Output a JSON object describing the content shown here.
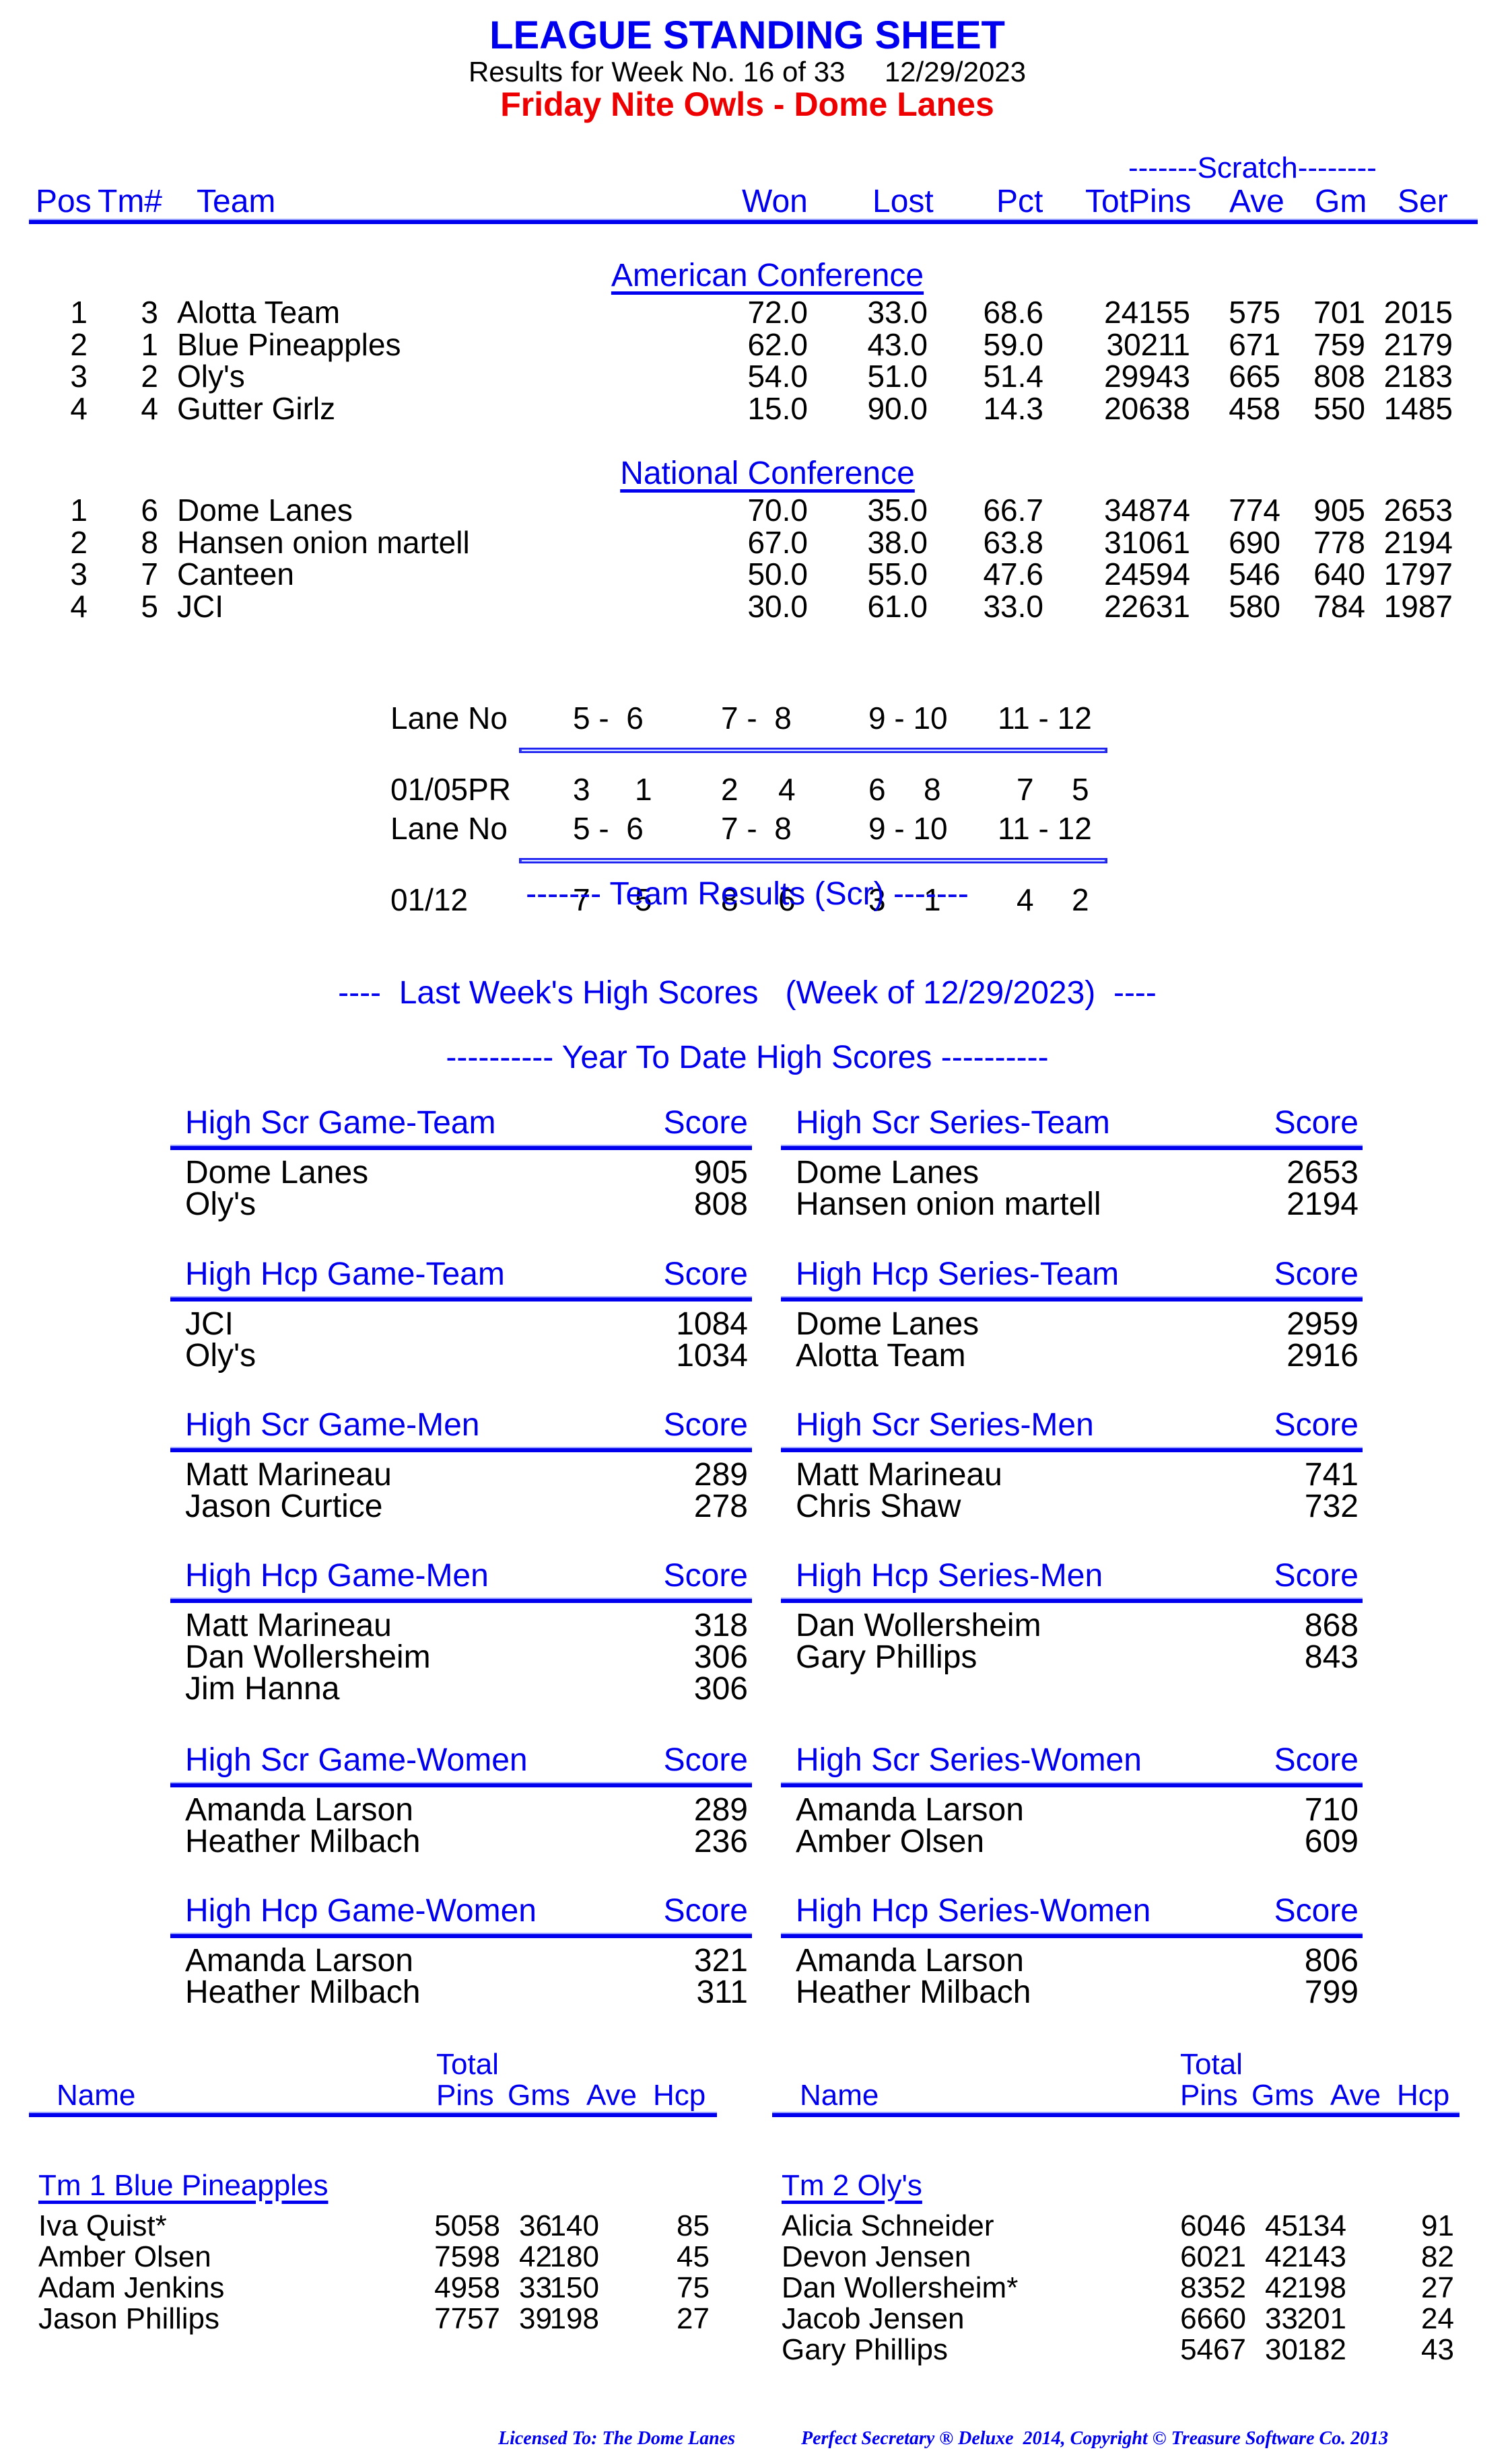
{
  "header": {
    "title": "LEAGUE STANDING SHEET",
    "subtitle": "Results for Week No. 16 of 33     12/29/2023",
    "league": "Friday Nite Owls - Dome Lanes"
  },
  "standings": {
    "scratch_label": "-------Scratch--------",
    "columns": {
      "pos": "Pos",
      "tm": "Tm#",
      "team": "Team",
      "won": "Won",
      "lost": "Lost",
      "pct": "Pct",
      "totpins": "TotPins",
      "ave": "Ave",
      "gm": "Gm",
      "ser": "Ser"
    },
    "conferences": [
      {
        "name": "American Conference",
        "rows": [
          {
            "pos": "1",
            "tm": "3",
            "team": "Alotta Team",
            "won": "72.0",
            "lost": "33.0",
            "pct": "68.6",
            "totpins": "24155",
            "ave": "575",
            "gm": "701",
            "ser": "2015"
          },
          {
            "pos": "2",
            "tm": "1",
            "team": "Blue Pineapples",
            "won": "62.0",
            "lost": "43.0",
            "pct": "59.0",
            "totpins": "30211",
            "ave": "671",
            "gm": "759",
            "ser": "2179"
          },
          {
            "pos": "3",
            "tm": "2",
            "team": "Oly's",
            "won": "54.0",
            "lost": "51.0",
            "pct": "51.4",
            "totpins": "29943",
            "ave": "665",
            "gm": "808",
            "ser": "2183"
          },
          {
            "pos": "4",
            "tm": "4",
            "team": "Gutter Girlz",
            "won": "15.0",
            "lost": "90.0",
            "pct": "14.3",
            "totpins": "20638",
            "ave": "458",
            "gm": "550",
            "ser": "1485"
          }
        ]
      },
      {
        "name": "National Conference",
        "rows": [
          {
            "pos": "1",
            "tm": "6",
            "team": "Dome Lanes",
            "won": "70.0",
            "lost": "35.0",
            "pct": "66.7",
            "totpins": "34874",
            "ave": "774",
            "gm": "905",
            "ser": "2653"
          },
          {
            "pos": "2",
            "tm": "8",
            "team": "Hansen onion martell",
            "won": "67.0",
            "lost": "38.0",
            "pct": "63.8",
            "totpins": "31061",
            "ave": "690",
            "gm": "778",
            "ser": "2194"
          },
          {
            "pos": "3",
            "tm": "7",
            "team": "Canteen",
            "won": "50.0",
            "lost": "55.0",
            "pct": "47.6",
            "totpins": "24594",
            "ave": "546",
            "gm": "640",
            "ser": "1797"
          },
          {
            "pos": "4",
            "tm": "5",
            "team": "JCI",
            "won": "30.0",
            "lost": "61.0",
            "pct": "33.0",
            "totpins": "22631",
            "ave": "580",
            "gm": "784",
            "ser": "1987"
          }
        ]
      }
    ]
  },
  "lanes": [
    {
      "label": "Lane No",
      "pairs": [
        "5 -  6",
        "7 -  8",
        "9 - 10",
        "11 - 12"
      ],
      "date": "01/05PR",
      "teams": [
        "3",
        "1",
        "2",
        "4",
        "6",
        "8",
        "7",
        "5"
      ]
    },
    {
      "label": "Lane No",
      "pairs": [
        "5 -  6",
        "7 -  8",
        "9 - 10",
        "11 - 12"
      ],
      "date": "01/12",
      "teams": [
        "7",
        "5",
        "8",
        "6",
        "3",
        "1",
        "4",
        "2"
      ]
    }
  ],
  "sections": {
    "team_results": "------- Team Results (Scr) -------",
    "last_week": "----  Last Week's High Scores   (Week of 12/29/2023)  ----",
    "ytd": "---------- Year To Date High Scores ----------"
  },
  "high_scores": {
    "score_label": "Score",
    "blocks": [
      {
        "title": "High Scr Game-Team",
        "entries": [
          {
            "name": "Dome Lanes",
            "score": "905"
          },
          {
            "name": "Oly's",
            "score": "808"
          }
        ]
      },
      {
        "title": "High Scr Series-Team",
        "entries": [
          {
            "name": "Dome Lanes",
            "score": "2653"
          },
          {
            "name": "Hansen onion martell",
            "score": "2194"
          }
        ]
      },
      {
        "title": "High Hcp Game-Team",
        "entries": [
          {
            "name": "JCI",
            "score": "1084"
          },
          {
            "name": "Oly's",
            "score": "1034"
          }
        ]
      },
      {
        "title": "High Hcp Series-Team",
        "entries": [
          {
            "name": "Dome Lanes",
            "score": "2959"
          },
          {
            "name": "Alotta Team",
            "score": "2916"
          }
        ]
      },
      {
        "title": "High Scr Game-Men",
        "entries": [
          {
            "name": "Matt Marineau",
            "score": "289"
          },
          {
            "name": "Jason Curtice",
            "score": "278"
          }
        ]
      },
      {
        "title": "High Scr Series-Men",
        "entries": [
          {
            "name": "Matt Marineau",
            "score": "741"
          },
          {
            "name": "Chris Shaw",
            "score": "732"
          }
        ]
      },
      {
        "title": "High Hcp Game-Men",
        "entries": [
          {
            "name": "Matt Marineau",
            "score": "318"
          },
          {
            "name": "Dan Wollersheim",
            "score": "306"
          },
          {
            "name": "Jim Hanna",
            "score": "306"
          }
        ]
      },
      {
        "title": "High Hcp Series-Men",
        "entries": [
          {
            "name": "Dan Wollersheim",
            "score": "868"
          },
          {
            "name": "Gary Phillips",
            "score": "843"
          }
        ]
      },
      {
        "title": "High Scr Game-Women",
        "entries": [
          {
            "name": "Amanda Larson",
            "score": "289"
          },
          {
            "name": "Heather Milbach",
            "score": "236"
          }
        ]
      },
      {
        "title": "High Scr Series-Women",
        "entries": [
          {
            "name": "Amanda Larson",
            "score": "710"
          },
          {
            "name": "Amber Olsen",
            "score": "609"
          }
        ]
      },
      {
        "title": "High Hcp Game-Women",
        "entries": [
          {
            "name": "Amanda Larson",
            "score": "321"
          },
          {
            "name": "Heather Milbach",
            "score": "311"
          }
        ]
      },
      {
        "title": "High Hcp Series-Women",
        "entries": [
          {
            "name": "Amanda Larson",
            "score": "806"
          },
          {
            "name": "Heather Milbach",
            "score": "799"
          }
        ]
      }
    ]
  },
  "rosters": {
    "columns": {
      "total": "Total",
      "name": "Name",
      "pins": "Pins",
      "gms": "Gms",
      "ave": "Ave",
      "hcp": "Hcp"
    },
    "teams": [
      {
        "title": "Tm 1 Blue Pineapples",
        "players": [
          {
            "name": "Iva Quist*",
            "pins": "5058",
            "gms": "36",
            "ave": "140",
            "hcp": "85"
          },
          {
            "name": "Amber Olsen",
            "pins": "7598",
            "gms": "42",
            "ave": "180",
            "hcp": "45"
          },
          {
            "name": "Adam Jenkins",
            "pins": "4958",
            "gms": "33",
            "ave": "150",
            "hcp": "75"
          },
          {
            "name": "Jason Phillips",
            "pins": "7757",
            "gms": "39",
            "ave": "198",
            "hcp": "27"
          }
        ]
      },
      {
        "title": "Tm 2 Oly's",
        "players": [
          {
            "name": "Alicia Schneider",
            "pins": "6046",
            "gms": "45",
            "ave": "134",
            "hcp": "91"
          },
          {
            "name": "Devon Jensen",
            "pins": "6021",
            "gms": "42",
            "ave": "143",
            "hcp": "82"
          },
          {
            "name": "Dan Wollersheim*",
            "pins": "8352",
            "gms": "42",
            "ave": "198",
            "hcp": "27"
          },
          {
            "name": "Jacob Jensen",
            "pins": "6660",
            "gms": "33",
            "ave": "201",
            "hcp": "24"
          },
          {
            "name": "Gary Phillips",
            "pins": "5467",
            "gms": "30",
            "ave": "182",
            "hcp": "43"
          }
        ]
      }
    ]
  },
  "footer": {
    "licensed": "Licensed To: The Dome Lanes",
    "copyright": "Perfect Secretary ® Deluxe  2014, Copyright © Treasure Software Co. 2013"
  }
}
